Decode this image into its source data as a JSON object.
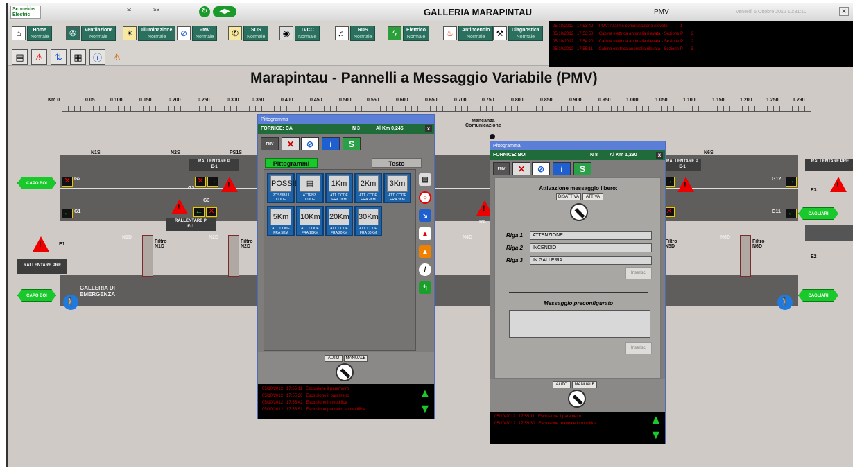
{
  "topbar": {
    "logo_l1": "Schneider",
    "logo_l2": "Electric",
    "field1": "S:",
    "field2": "SB",
    "title": "GALLERIA MARAPINTAU",
    "page_code": "PMV",
    "datetime": "Venerdì 5 Ottobre 2012 10:31:10",
    "close_label": "X"
  },
  "modules": [
    {
      "icon": "⌂",
      "label": "Home",
      "status": "Normale"
    },
    {
      "icon": "✇",
      "label": "Ventilazione",
      "status": "Normale"
    },
    {
      "icon": "☀",
      "label": "Illuminazione",
      "status": "Normale"
    },
    {
      "icon": "⊘",
      "label": "PMV",
      "status": "Normale"
    },
    {
      "icon": "✆",
      "label": "SOS",
      "status": "Normale"
    },
    {
      "icon": "◉",
      "label": "TVCC",
      "status": "Normale"
    },
    {
      "icon": "♬",
      "label": "RDS",
      "status": "Normale"
    },
    {
      "icon": "ϟ",
      "label": "Elettrico",
      "status": "Normale"
    },
    {
      "icon": "♨",
      "label": "Antincendio",
      "status": "Normale"
    },
    {
      "icon": "⚒",
      "label": "Diagnostica",
      "status": "Normale"
    }
  ],
  "tools": [
    "▤",
    "⚠",
    "⇅",
    "▦",
    "ⓘ",
    "⚠"
  ],
  "alarms": [
    {
      "date": "05/10/2012",
      "time": "17:53:42",
      "text": "PMV: Allarme comunicazione rilevato",
      "code": "1"
    },
    {
      "date": "05/10/2012",
      "time": "17:53:50",
      "text": "Cabina elettrica anomalia rilevata - Sezione P",
      "code": "2"
    },
    {
      "date": "05/10/2012",
      "time": "17:54:20",
      "text": "Cabina elettrica anomalia rilevata - Sezione P",
      "code": "2"
    },
    {
      "date": "05/10/2012",
      "time": "17:55:11",
      "text": "Cabina elettrica anomalia rilevata - Sezione P",
      "code": "3"
    }
  ],
  "page_heading": "Marapintau - Pannelli a Messaggio Variabile (PMV)",
  "km_scale": [
    "Km 0",
    "0.05",
    "0.100",
    "0.150",
    "0.200",
    "0.250",
    "0.300",
    "0.350",
    "0.400",
    "0.450",
    "0.500",
    "0.550",
    "0.600",
    "0.650",
    "0.700",
    "0.750",
    "0.800",
    "0.850",
    "0.900",
    "0.950",
    "1.000",
    "1.050",
    "1.100",
    "1.150",
    "1.200",
    "1.250",
    "1.290"
  ],
  "tunnel": {
    "missing_comm": "Mancanza\nComunicazione",
    "rallentare": "RALLENTARE P",
    "rallentare_sub": "E-1",
    "rallentare_pre": "RALLENTARE PRE",
    "emergency": "GALLERIA DI\nEMERGENZA",
    "capo_boi": "CAPO BOI",
    "cagliari": "CAGLIARI",
    "labels": {
      "n1s": "N1S",
      "n2s": "N2S",
      "ps1s": "PS1S",
      "n5s": "N5S",
      "n6s": "N6S",
      "n1d": "N1D",
      "n2d": "N2D",
      "n4d": "N4D",
      "n6d": "N6D",
      "g1": "G1",
      "g2": "G2",
      "g3": "G3",
      "g3b": "G3",
      "g11": "G11",
      "g12": "G12",
      "e1": "E1",
      "e2": "E2",
      "e3": "E3",
      "filtro_n1d": "Filtro\nN1D",
      "filtro_n2d": "Filtro\nN2D",
      "filtro_n5d": "Filtro\nN5D",
      "filtro_n6d": "Filtro\nN6D",
      "ra": "RA",
      "p": "P"
    }
  },
  "dialog1": {
    "title": "Pittogramma",
    "head": "FORNICE: CA",
    "n": "N 3",
    "km": "Al Km 0,245",
    "close": "x",
    "tab_pict": "Pittogrammi",
    "tab_text": "Testo",
    "pictograms": [
      {
        "label": "POSSIBILI CODE",
        "tag": "POSSIBILI"
      },
      {
        "label": "ATTENZ. CODE",
        "tag": ""
      },
      {
        "label": "ATT. CODE FRA 1KM",
        "tag": "1Km"
      },
      {
        "label": "ATT. CODE FRA 2KM",
        "tag": "2Km"
      },
      {
        "label": "ATT. CODE FRA 3KM",
        "tag": "3Km"
      },
      {
        "label": "ATT. CODE FRA 5KM",
        "tag": "5Km"
      },
      {
        "label": "ATT. CODE FRA 10KM",
        "tag": "10Km"
      },
      {
        "label": "ATT. CODE FRA 20KM",
        "tag": "20Km"
      },
      {
        "label": "ATT. CODE FRA 30KM",
        "tag": "30Km"
      }
    ],
    "auto": "AUTO",
    "manuale": "MANUALE",
    "log": [
      {
        "date": "05/10/2012",
        "time": "17:55:11",
        "text": "Esclusione il parametro"
      },
      {
        "date": "05/10/2012",
        "time": "17:55:30",
        "text": "Esclusione il parametro"
      },
      {
        "date": "05/10/2012",
        "time": "17:55:42",
        "text": "Esclusione in modifica"
      },
      {
        "date": "05/10/2012",
        "time": "17:55:51",
        "text": "Esclusione pannello su modifica"
      }
    ]
  },
  "dialog2": {
    "title": "Pittogramma",
    "head": "FORNICE: BOI",
    "n": "N 8",
    "km": "Al Km 1,290",
    "close": "x",
    "free_msg": "Attivazione messaggio libero:",
    "disattiva": "DISATTIVA",
    "attiva": "ATTIVA",
    "riga1_label": "Riga 1",
    "riga1": "ATTENZIONE",
    "riga2_label": "Riga 2",
    "riga2": "INCENDIO",
    "riga3_label": "Riga 3",
    "riga3": "IN GALLERIA",
    "inserisci": "Inserisci",
    "preconf": "Messaggio preconfigurato",
    "inserisci2": "Inserisci",
    "auto": "AUTO",
    "manuale": "MANUALE",
    "log": [
      {
        "date": "05/10/2012",
        "time": "17:55:11",
        "text": "Esclusione il parametro"
      },
      {
        "date": "05/10/2012",
        "time": "17:55:30",
        "text": "Esclusione manuale in modifica"
      }
    ]
  },
  "colors": {
    "accent_green": "#19c82a",
    "alarm_red": "#cc0000",
    "header_green": "#1f6b3a",
    "title_blue": "#5b7fd6"
  }
}
